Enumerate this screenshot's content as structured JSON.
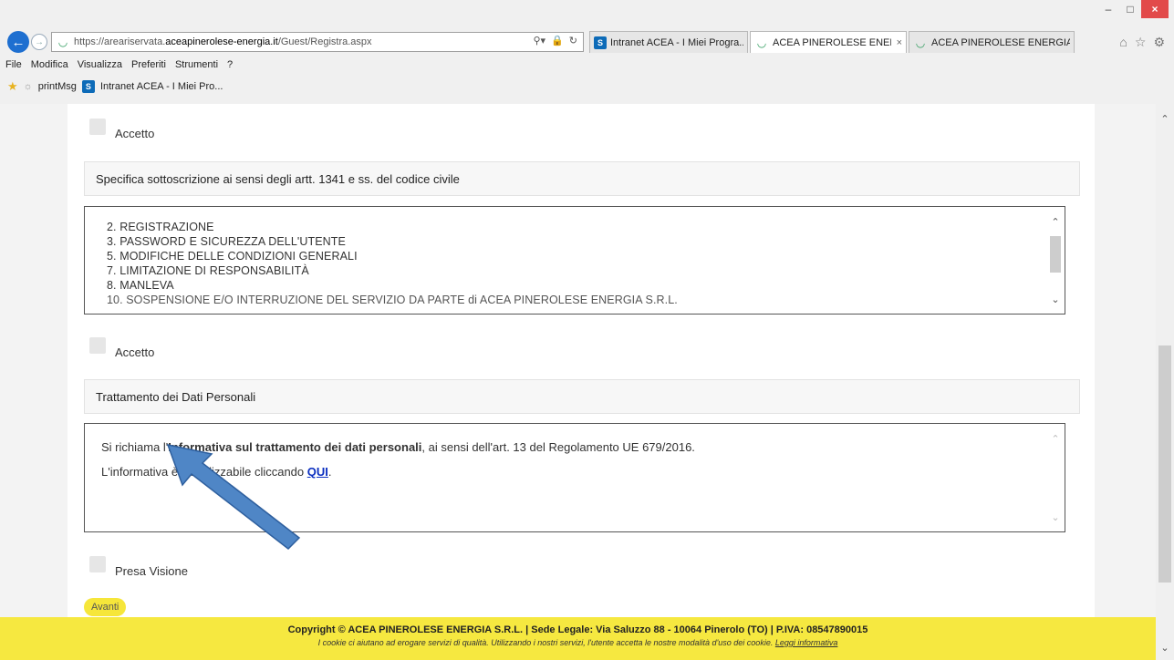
{
  "browser": {
    "url_prefix": "https://areariservata.",
    "url_domain": "aceapinerolese-energia.it",
    "url_path": "/Guest/Registra.aspx",
    "tabs": [
      {
        "label": "Intranet ACEA - I Miei Progra...",
        "icon": "sharepoint-icon",
        "active": false,
        "closable": false
      },
      {
        "label": "ACEA PINEROLESE ENER...",
        "icon": "acea-icon",
        "active": true,
        "closable": true
      },
      {
        "label": "ACEA PINEROLESE ENERGIA ...",
        "icon": "acea-icon",
        "active": false,
        "closable": false
      }
    ],
    "menu": [
      "File",
      "Modifica",
      "Visualizza",
      "Preferiti",
      "Strumenti",
      "?"
    ],
    "favorites": [
      "printMsg",
      "Intranet ACEA - I Miei Pro..."
    ]
  },
  "page": {
    "accept1_label": "Accetto",
    "clauses_title": "Specifica sottoscrizione ai sensi degli artt. 1341 e ss. del codice civile",
    "clauses": [
      "2. REGISTRAZIONE",
      "3. PASSWORD E SICUREZZA DELL'UTENTE",
      "5. MODIFICHE DELLE CONDIZIONI GENERALI",
      "7. LIMITAZIONE DI RESPONSABILITÀ",
      "8. MANLEVA",
      "10. SOSPENSIONE E/O INTERRUZIONE DEL SERVIZIO DA PARTE di ACEA PINEROLESE ENERGIA S.R.L."
    ],
    "accept2_label": "Accetto",
    "privacy_title": "Trattamento dei Dati Personali",
    "privacy_text_pre": "Si richiama l'",
    "privacy_text_bold": "Informativa sul trattamento dei dati personali",
    "privacy_text_post": ", ai sensi dell'art. 13 del Regolamento UE 679/2016.",
    "privacy_link_pre": "L'informativa è visualizzabile cliccando ",
    "privacy_link": "QUI",
    "privacy_link_post": ".",
    "presa_visione_label": "Presa Visione",
    "next_button": "Avanti"
  },
  "footer": {
    "line1": "Copyright © ACEA PINEROLESE ENERGIA S.R.L.  | Sede Legale: Via Saluzzo 88 - 10064 Pinerolo (TO) | P.IVA: 08547890015",
    "line2_text": "I cookie ci aiutano ad erogare servizi di qualità. Utilizzando i nostri servizi, l'utente accetta le nostre modalità d'uso dei cookie. ",
    "line2_link": "Leggi informativa"
  },
  "annotation": {
    "arrow_color": "#4f86c6"
  }
}
